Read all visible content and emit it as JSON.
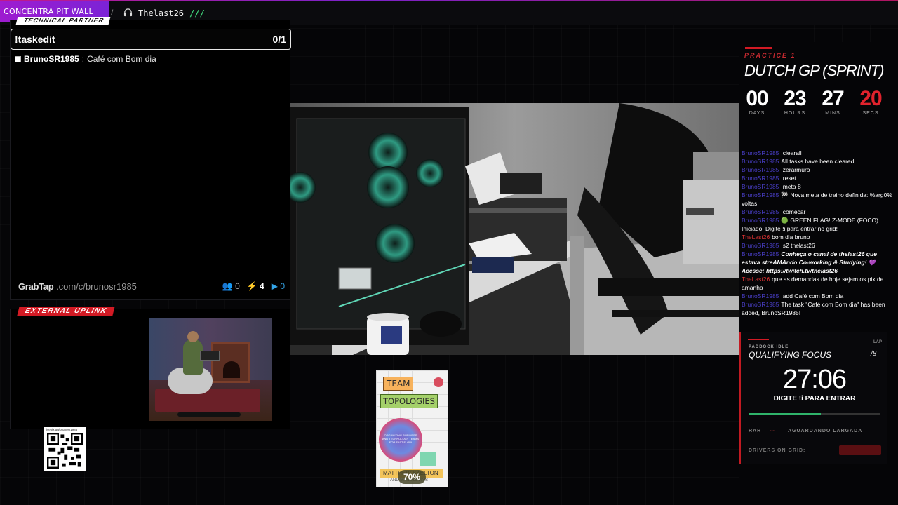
{
  "brand": {
    "name": "CONCENTRA PIT WALL",
    "separator": "/"
  },
  "top": {
    "username": "Thelast26",
    "slashes": "///",
    "headset_icon": "headset-icon"
  },
  "tech_partner": "TECHNICAL PARTNER",
  "task": {
    "title": "!taskedit",
    "count": "0/1",
    "items": [
      {
        "user": "BrunoSR1985",
        "sep": ":",
        "text": "Café com Bom dia"
      }
    ]
  },
  "grabtap": {
    "logo": "GrabTap",
    "path": ".com/c/brunosr1985",
    "stats": {
      "people": "0",
      "bolts": "4",
      "plays": "0"
    }
  },
  "external": {
    "badge": "EXTERNAL UPLINK"
  },
  "qr": {
    "label": "livepix.gg/brunosr1985"
  },
  "book": {
    "title1": "TEAM",
    "title2": "TOPOLOGIES",
    "circle_text": "ORGANIZING BUSINESS AND TECHNOLOGY TEAMS FOR FAST FLOW",
    "authors": "MATTHEW SKELTON",
    "authors2": "AND MANUEL PAIS",
    "progress": "70%"
  },
  "race": {
    "session": "PRACTICE 1",
    "title": "DUTCH GP (SPRINT)",
    "countdown": [
      {
        "value": "00",
        "unit": "DAYS"
      },
      {
        "value": "23",
        "unit": "HOURS"
      },
      {
        "value": "27",
        "unit": "MINS"
      },
      {
        "value": "20",
        "unit": "SECS"
      }
    ]
  },
  "chat": [
    {
      "user": "BrunoSR1985",
      "text": "!clearall"
    },
    {
      "user": "BrunoSR1985",
      "text": "All tasks have been cleared"
    },
    {
      "user": "BrunoSR1985",
      "text": "!zerarmuro"
    },
    {
      "user": "BrunoSR1985",
      "text": "!reset"
    },
    {
      "user": "BrunoSR1985",
      "text": "!meta 8"
    },
    {
      "user": "BrunoSR1985",
      "text": "🏁 Nova meta de treino definida: %arg0% voltas."
    },
    {
      "user": "BrunoSR1985",
      "text": "!comecar"
    },
    {
      "user": "BrunoSR1985",
      "text": "🟢 GREEN FLAG! Z-MODE (FOCO) Iniciado. Digite !i para entrar no grid!"
    },
    {
      "user": "TheLast26",
      "text": "bom dia bruno",
      "red": true
    },
    {
      "user": "BrunoSR1985",
      "text": "!s2 thelast26"
    },
    {
      "user": "BrunoSR1985",
      "text": "Conheça o canal de thelast26 que estava streAMAndo Co-working & Studying! 💜",
      "italic": true
    },
    {
      "user": "",
      "text": "Acesse: https://twitch.tv/thelast26",
      "italic": true
    },
    {
      "user": "TheLast26",
      "text": "que as demandas de hoje sejam os pix de amanha",
      "red": true
    },
    {
      "user": "BrunoSR1985",
      "text": "!add Café com Bom dia"
    },
    {
      "user": "BrunoSR1985",
      "text": "The task \"Café com Bom dia\" has been added, BrunoSR1985!"
    }
  ],
  "focus": {
    "paddock": "PADDOCK IDLE",
    "lap_label": "LAP",
    "lap": "/8",
    "title": "QUALIFYING FOCUS",
    "time": "27:06",
    "subtitle": "DIGITE !i PARA ENTRAR",
    "progress": 0.55,
    "rar": "RAR",
    "dash": "---",
    "status": "AGUARDANDO LARGADA",
    "drivers": "DRIVERS ON GRID:"
  },
  "colors": {
    "accent_red": "#d21a24",
    "brand_purple": "#9e1cd0",
    "green": "#2fb36a"
  }
}
